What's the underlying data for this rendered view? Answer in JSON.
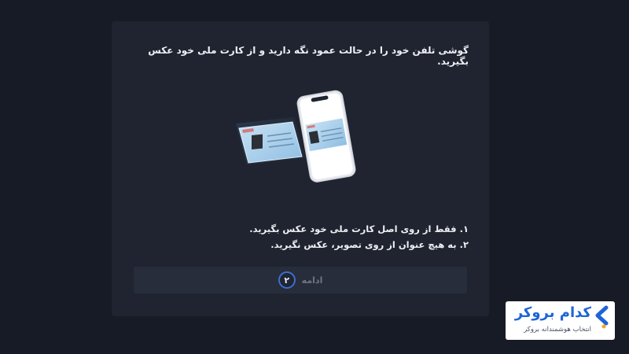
{
  "instruction": "گوشی تلفن خود را در حالت عمود نگه دارید و از کارت ملی خود عکس بگیرید.",
  "notes": [
    "۱. فقط از روی اصل کارت ملی خود عکس بگیرید.",
    "۲. به هیچ عنوان از روی تصویر، عکس نگیرید."
  ],
  "continue_button": {
    "label": "ادامه",
    "step": "۲"
  },
  "brand": {
    "name": "کدام بروکر",
    "tagline": "انتخاب هوشمندانه بروکر"
  },
  "colors": {
    "background": "#171b25",
    "card": "#1f2430",
    "button": "#272d3b",
    "accent": "#3d6fc8",
    "brand_blue": "#1e64d8",
    "brand_orange": "#f5a623"
  },
  "icons": {
    "illustration": "phone-photographing-id-card",
    "brand_logo": "kodam-broker-chevron-logo"
  }
}
